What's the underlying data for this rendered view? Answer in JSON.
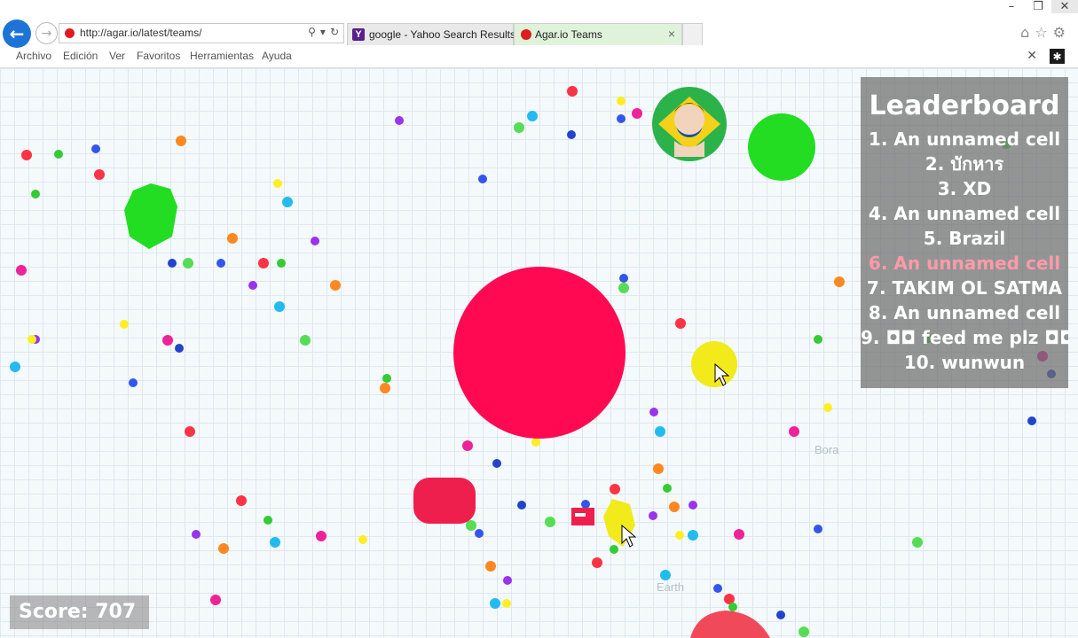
{
  "browser": {
    "address": "http://agar.io/latest/teams/",
    "tabs": [
      {
        "label": "google - Yahoo Search Results",
        "favicon": "yahoo-icon",
        "active": false
      },
      {
        "label": "Agar.io Teams",
        "favicon": "agar-icon",
        "active": true
      }
    ],
    "yahoo_favicon_letter": "Y",
    "menu": [
      "Archivo",
      "Edición",
      "Ver",
      "Favoritos",
      "Herramientas",
      "Ayuda"
    ],
    "colors": {
      "back_button": "#1e73d6",
      "active_tab": "#dff3da",
      "favicon_red": "#e01b22"
    }
  },
  "game": {
    "leaderboard": {
      "title": "Leaderboard",
      "entries": [
        "1. An unnamed cell",
        "2. บักหาร",
        "3. XD",
        "4. An unnamed cell",
        "5. Brazil",
        "6. An unnamed cell",
        "7. TAKIM OL SATMA",
        "8. An unnamed cell",
        "9. ◘◘ feed me plz ◘◘",
        "10. wunwun"
      ],
      "highlight_index": 5,
      "highlight_color": "#ff9aa8"
    },
    "score": "Score: 707",
    "faint_labels": [
      "Earth",
      "Bora"
    ],
    "colors": {
      "player_cell": "#ff0a52",
      "green_cell": "#22dd22",
      "yellow_cell": "#f2ea1a",
      "red_cell": "#ee1f4c"
    }
  }
}
